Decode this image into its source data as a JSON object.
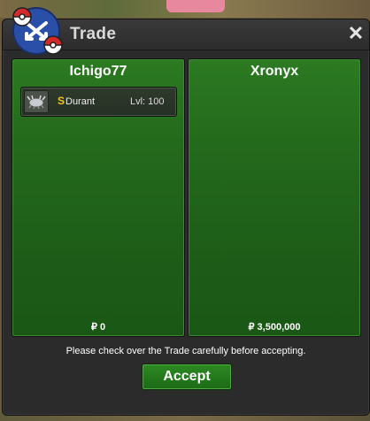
{
  "window": {
    "title": "Trade",
    "close_glyph": "✕"
  },
  "left_panel": {
    "player_name": "Ichigo77",
    "items": [
      {
        "icon": "durant-icon",
        "shiny_glyph": "S",
        "name": "Durant",
        "level": "Lvl: 100"
      }
    ],
    "money": "₽ 0"
  },
  "right_panel": {
    "player_name": "Xronyx",
    "items": [],
    "money": "₽ 3,500,000"
  },
  "footer": {
    "notice": "Please check over the Trade carefully before accepting.",
    "accept_label": "Accept"
  },
  "colors": {
    "panel_green": "#246a1c",
    "button_green": "#2d8a22",
    "shiny_gold": "#f0c419",
    "window_bg": "#2b2b2b"
  }
}
